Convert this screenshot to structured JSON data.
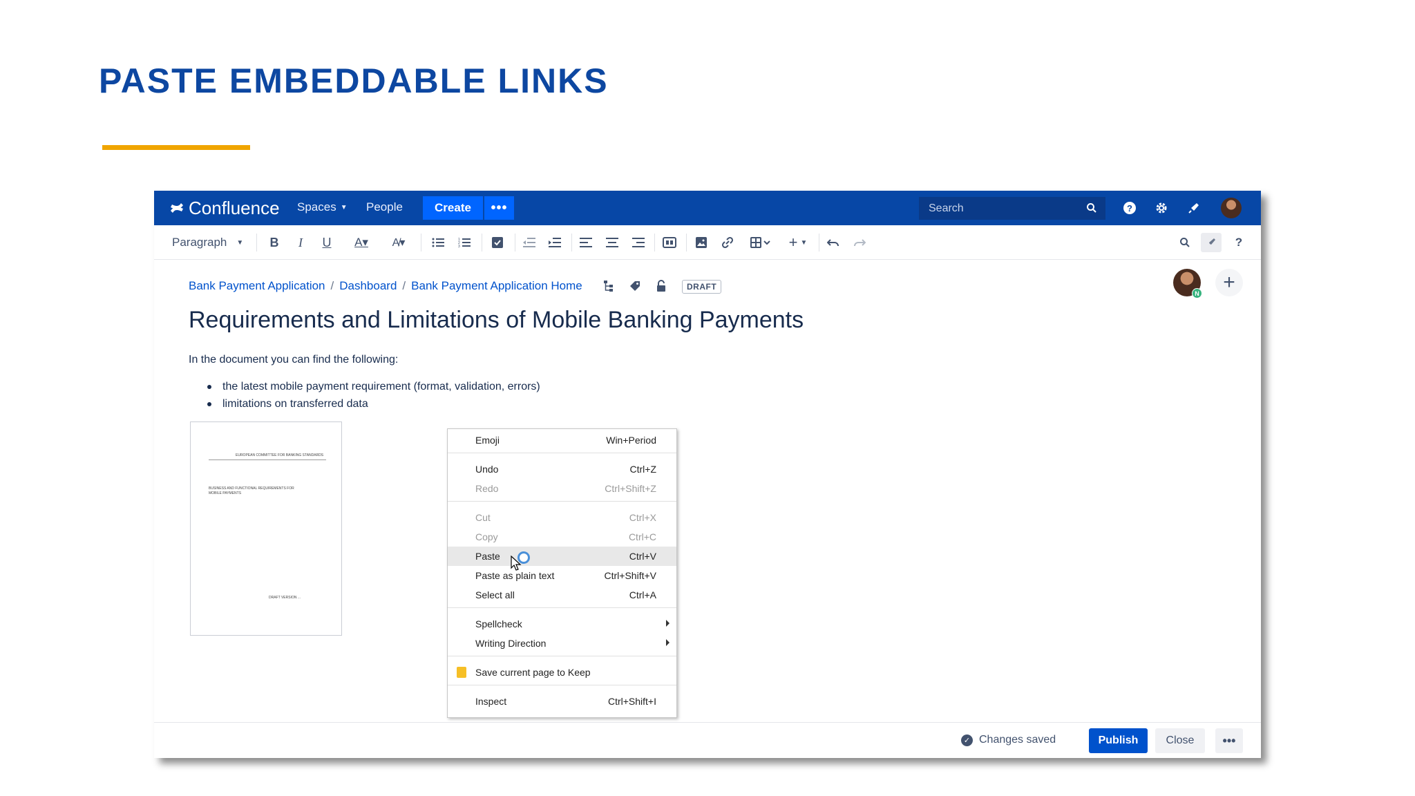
{
  "slide": {
    "title": "PASTE EMBEDDABLE LINKS",
    "accent_color": "#f0a500",
    "title_color": "#0d47a1"
  },
  "navbar": {
    "brand": "Confluence",
    "spaces_label": "Spaces",
    "people_label": "People",
    "create_label": "Create",
    "more_label": "•••",
    "search_placeholder": "Search",
    "icons": [
      "help-icon",
      "settings-icon",
      "notifications-icon",
      "avatar"
    ],
    "bg_color": "#0747a6"
  },
  "toolbar": {
    "paragraph_label": "Paragraph",
    "buttons": [
      "bold",
      "italic",
      "underline",
      "text-color",
      "text-style",
      "bullet-list",
      "numbered-list",
      "task",
      "outdent",
      "indent",
      "align-left",
      "align-center",
      "align-right",
      "layout",
      "image",
      "link",
      "table",
      "insert",
      "undo",
      "redo",
      "find",
      "editor-rocket",
      "help"
    ]
  },
  "page": {
    "breadcrumb": [
      "Bank Payment Application",
      "Dashboard",
      "Bank Payment Application Home"
    ],
    "status_badge": "DRAFT",
    "collaborator_badge": "N",
    "title": "Requirements and Limitations of Mobile Banking Payments",
    "intro": "In the document you can find the following:",
    "bullets": [
      "the latest mobile payment requirement (format, validation, errors)",
      "limitations on transferred data"
    ],
    "document": {
      "header": "EUROPEAN COMMITTEE FOR BANKING STANDARDS",
      "title_line1": "BUSINESS AND FUNCTIONAL REQUIREMENTS FOR",
      "title_line2": "MOBILE PAYMENTS",
      "version": "DRAFT VERSION ..."
    }
  },
  "context_menu": {
    "items": [
      {
        "label": "Emoji",
        "shortcut": "Win+Period",
        "disabled": false
      },
      {
        "label": "Undo",
        "shortcut": "Ctrl+Z",
        "disabled": false
      },
      {
        "label": "Redo",
        "shortcut": "Ctrl+Shift+Z",
        "disabled": true
      },
      {
        "label": "Cut",
        "shortcut": "Ctrl+X",
        "disabled": true
      },
      {
        "label": "Copy",
        "shortcut": "Ctrl+C",
        "disabled": true
      },
      {
        "label": "Paste",
        "shortcut": "Ctrl+V",
        "disabled": false,
        "hover": true
      },
      {
        "label": "Paste as plain text",
        "shortcut": "Ctrl+Shift+V",
        "disabled": false
      },
      {
        "label": "Select all",
        "shortcut": "Ctrl+A",
        "disabled": false
      },
      {
        "label": "Spellcheck",
        "shortcut": "",
        "submenu": true
      },
      {
        "label": "Writing Direction",
        "shortcut": "",
        "submenu": true
      },
      {
        "label": "Save current page to Keep",
        "shortcut": "",
        "icon": "keep-icon"
      },
      {
        "label": "Inspect",
        "shortcut": "Ctrl+Shift+I",
        "disabled": false
      }
    ]
  },
  "footer": {
    "status": "Changes saved",
    "publish_label": "Publish",
    "close_label": "Close",
    "more_label": "•••"
  }
}
